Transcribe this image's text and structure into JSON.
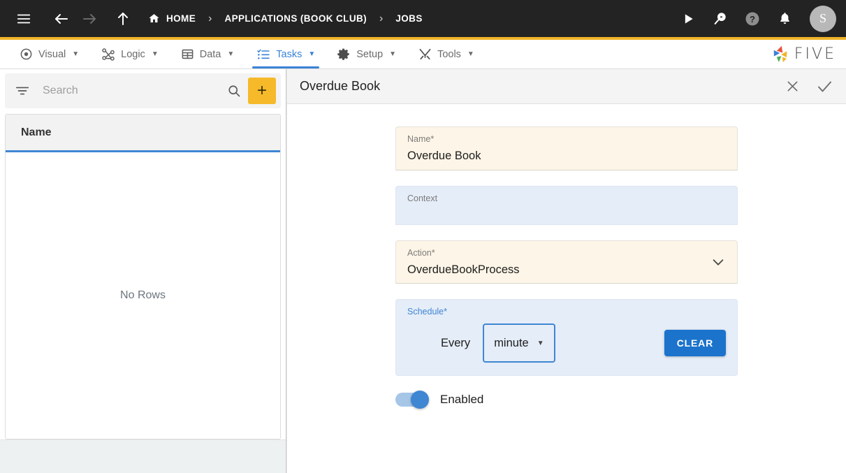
{
  "topbar": {
    "menu_icon": "hamburger-menu-icon",
    "back_icon": "arrow-left-icon",
    "forward_icon": "arrow-right-icon",
    "up_icon": "arrow-up-icon",
    "breadcrumbs": [
      {
        "label": "HOME",
        "icon": "home-icon"
      },
      {
        "label": "APPLICATIONS (BOOK CLUB)",
        "icon": ""
      },
      {
        "label": "JOBS",
        "icon": ""
      }
    ],
    "separator": "›",
    "actions": [
      {
        "name": "run-icon",
        "label": "Run"
      },
      {
        "name": "debug-icon",
        "label": "Debug"
      },
      {
        "name": "help-icon",
        "label": "Help"
      },
      {
        "name": "notifications-icon",
        "label": "Notifications"
      }
    ],
    "avatar_initial": "S",
    "accent_color": "#f0b429",
    "background_color": "#232323"
  },
  "menubar": {
    "items": [
      {
        "label": "Visual",
        "icon": "eye-icon",
        "active": false
      },
      {
        "label": "Logic",
        "icon": "logic-nodes-icon",
        "active": false
      },
      {
        "label": "Data",
        "icon": "table-icon",
        "active": false
      },
      {
        "label": "Tasks",
        "icon": "checklist-icon",
        "active": true
      },
      {
        "label": "Setup",
        "icon": "gear-icon",
        "active": false
      },
      {
        "label": "Tools",
        "icon": "tools-icon",
        "active": false
      }
    ],
    "caret": "▼",
    "active_color": "#3b82d6",
    "logo_text": "FIVE"
  },
  "list_pane": {
    "filter_icon": "filter-icon",
    "search": {
      "placeholder": "Search",
      "value": ""
    },
    "search_icon": "search-icon",
    "add_button_label": "+",
    "add_button_color": "#f5b92a",
    "columns": [
      "Name"
    ],
    "rows": [],
    "empty_text": "No Rows"
  },
  "form": {
    "title": "Overdue Book",
    "close_icon": "close-icon",
    "save_icon": "check-icon",
    "fields": {
      "name": {
        "label": "Name",
        "required": "*",
        "value": "Overdue Book",
        "style": "cream"
      },
      "context": {
        "label": "Context",
        "required": "",
        "value": "",
        "style": "blue"
      },
      "action": {
        "label": "Action",
        "required": "*",
        "value": "OverdueBookProcess",
        "style": "cream",
        "chevron": "chevron-down-icon"
      }
    },
    "schedule": {
      "label": "Schedule",
      "required": "*",
      "every_text": "Every",
      "interval_value": "minute",
      "interval_caret": "▼",
      "clear_label": "CLEAR",
      "clear_color": "#1b73cc"
    },
    "enabled_toggle": {
      "label": "Enabled",
      "state": "on",
      "color": "#3f86d3"
    }
  },
  "annotation": {
    "type": "red-arrow",
    "color": "#e00000",
    "points_to": "save-check-button"
  }
}
